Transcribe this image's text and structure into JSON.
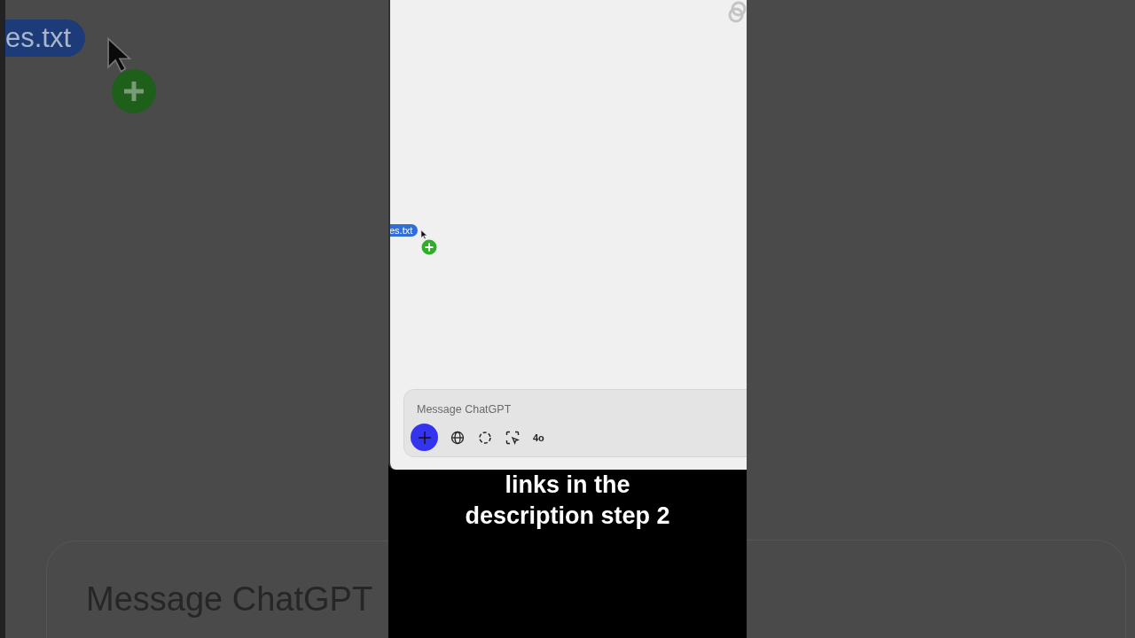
{
  "backdrop": {
    "file_chip": "es.txt",
    "message_placeholder": "Message ChatGPT"
  },
  "app": {
    "drag": {
      "file_chip": "es.txt"
    },
    "composer": {
      "placeholder": "Message ChatGPT",
      "model": "4o"
    }
  },
  "caption": "links in the description step 2"
}
